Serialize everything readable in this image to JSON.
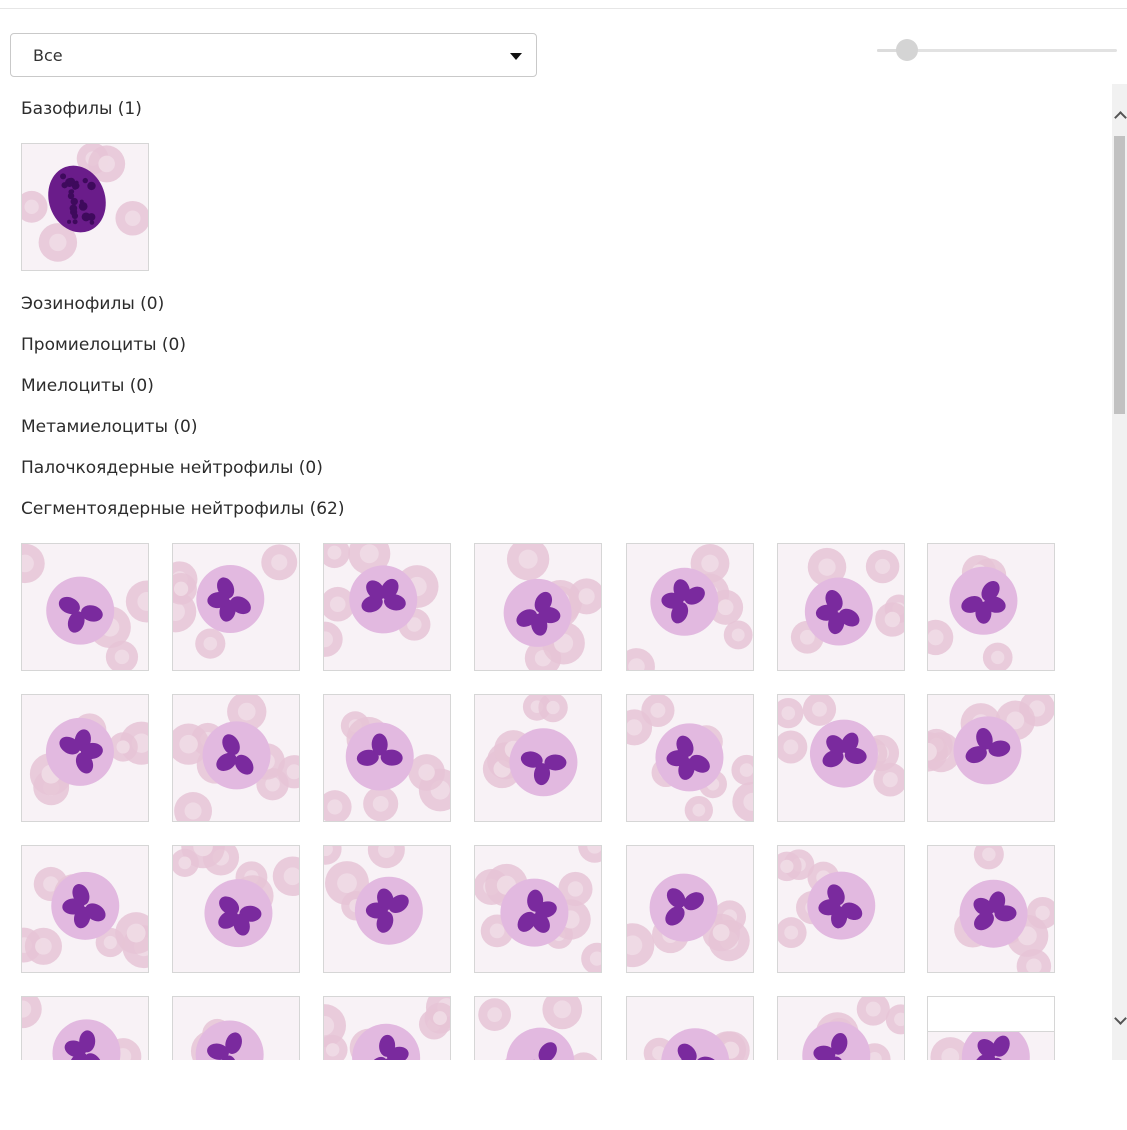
{
  "filter": {
    "selected": "Все"
  },
  "zoom_slider": {
    "value_fraction": 0.11
  },
  "categories": [
    {
      "label": "Базофилы (1)",
      "count": 1
    },
    {
      "label": "Эозинофилы (0)",
      "count": 0
    },
    {
      "label": "Промиелоциты (0)",
      "count": 0
    },
    {
      "label": "Миелоциты (0)",
      "count": 0
    },
    {
      "label": "Метамиелоциты (0)",
      "count": 0
    },
    {
      "label": "Палочкоядерные нейтрофилы (0)",
      "count": 0
    },
    {
      "label": "Сегментоядерные нейтрофилы (62)",
      "count": 62
    }
  ],
  "colors": {
    "cell_bg": "#f8f2f6",
    "rbc": "#e6c4d6",
    "cytoplasm": "#e2b9e0",
    "nucleus": "#7a2a9e",
    "basophil": "#6a1c8a"
  },
  "icons": {
    "dropdown": "caret-down-icon",
    "scroll_up": "chevron-up-icon",
    "scroll_down": "chevron-down-icon"
  }
}
